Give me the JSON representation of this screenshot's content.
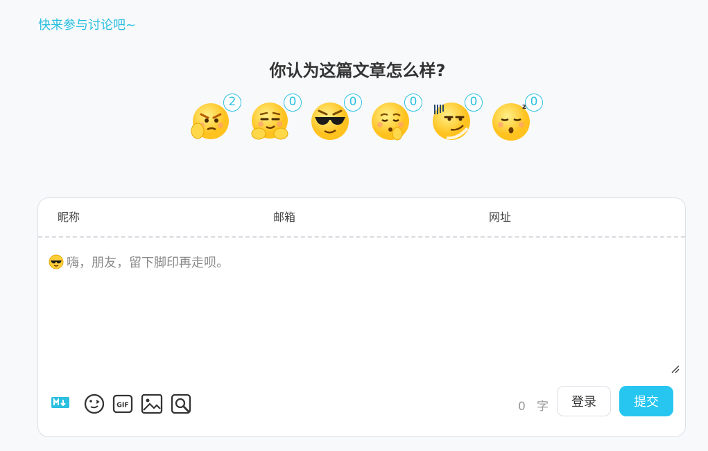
{
  "header": {
    "discuss_link": "快来参与讨论吧~"
  },
  "reaction_section": {
    "title": "你认为这篇文章怎么样?",
    "reactions": [
      {
        "icon": "angry-face-icon",
        "count": "2"
      },
      {
        "icon": "smug-face-icon",
        "count": "0"
      },
      {
        "icon": "sunglasses-face-icon",
        "count": "0"
      },
      {
        "icon": "thinking-face-icon",
        "count": "0"
      },
      {
        "icon": "speechless-face-icon",
        "count": "0"
      },
      {
        "icon": "sleepy-face-icon",
        "count": "0"
      }
    ]
  },
  "comment_form": {
    "nickname_placeholder": "昵称",
    "email_placeholder": "邮箱",
    "website_placeholder": "网址",
    "editor_placeholder": "嗨，朋友，留下脚印再走呗。",
    "word_count": "0",
    "word_unit": "字",
    "login_label": "登录",
    "submit_label": "提交"
  },
  "colors": {
    "accent": "#2bbfe0",
    "submit": "#26c6f0",
    "emoji_yellow": "#ffcf3a"
  }
}
